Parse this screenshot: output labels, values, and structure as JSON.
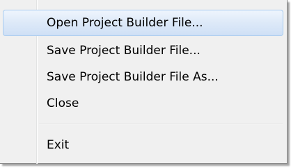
{
  "menu": {
    "items": [
      {
        "label": "Open Project Builder File...",
        "highlighted": true
      },
      {
        "label": "Save Project Builder File..."
      },
      {
        "label": "Save Project Builder File As..."
      },
      {
        "label": "Close"
      },
      {
        "label": "Exit"
      }
    ],
    "colors": {
      "background": "#f0f0f0",
      "highlight_border": "#a8cbef",
      "highlight_fill": "#dde9f8",
      "text": "#000000"
    }
  }
}
